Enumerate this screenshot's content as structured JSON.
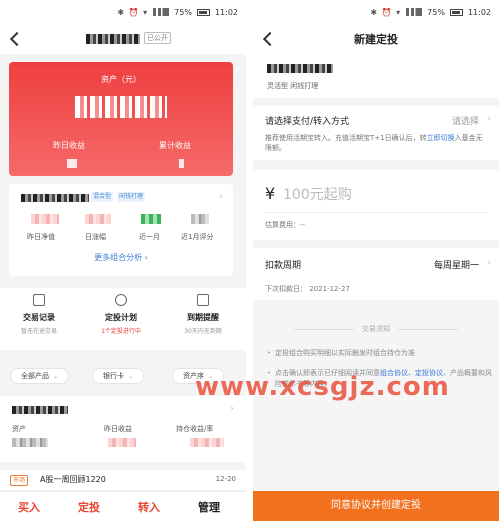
{
  "status": {
    "left_battery": "75%",
    "left_time": "11:02",
    "right_battery": "75%",
    "right_time": "11:02"
  },
  "left": {
    "header": {
      "public_badge": "已公开"
    },
    "asset_card": {
      "asset_label": "资产（元）",
      "yesterday_label": "昨日收益",
      "accumulated_label": "累计收益"
    },
    "fund_card": {
      "tag_type": "混合型",
      "tag_style": "闲钱打理",
      "metrics": [
        "昨日净值",
        "日涨幅",
        "近一月",
        "近1月评分"
      ],
      "more_analysis": "更多组合分析"
    },
    "quick_actions": [
      {
        "title": "交易记录",
        "sub": "暂无在途交易",
        "icon": "document-icon"
      },
      {
        "title": "定投计划",
        "sub": "1个定投进行中",
        "icon": "clock-icon"
      },
      {
        "title": "到期提醒",
        "sub": "30天内无到期",
        "icon": "alarm-icon"
      }
    ],
    "filters": [
      {
        "label": "全部产品"
      },
      {
        "label": "银行卡"
      },
      {
        "label": "资产序"
      }
    ],
    "holding": {
      "labels": [
        "资产",
        "昨日收益",
        "持仓收益/率"
      ]
    },
    "notice": {
      "market_tag": "市场",
      "text": "A股一周回顾1220",
      "date": "12-20"
    },
    "bottom_bar": [
      "买入",
      "定投",
      "转入",
      "管理"
    ],
    "bottom_colors": [
      "#e8452f",
      "#e8452f",
      "#e8452f",
      "#222222"
    ]
  },
  "right": {
    "title": "新建定投",
    "fund_tags": "灵活型  闲钱打理",
    "pay": {
      "title": "请选择支付/转入方式",
      "select_hint": "请选择",
      "desc_pre": "推荐使用活期宝转入。充值活期宝T+1日确认后，转",
      "desc_link": "立即切换",
      "desc_post": "入基金无限额。"
    },
    "amount": {
      "currency": "¥",
      "placeholder": "100元起购",
      "fee_label": "估算费用：--"
    },
    "cycle": {
      "title": "扣款周期",
      "value": "每周星期一",
      "next": "下次扣款日： 2021-12-27"
    },
    "notice_title": "交易须知",
    "notes": [
      {
        "text": "定投组合购买明细以实际触发时组合持仓为准",
        "link": ""
      },
      {
        "pre": "点击确认即表示已仔细阅读并同意",
        "link": "组合协议、定投协议",
        "post": "、产品概要和风险揭示书等内容。"
      }
    ],
    "agree_button": "同意协议并创建定投"
  },
  "watermark": "www.xcsgjz.com",
  "colors": {
    "accent_red": "#ef3f3f",
    "accent_orange": "#f2711e",
    "link_blue": "#3a7bd5"
  }
}
